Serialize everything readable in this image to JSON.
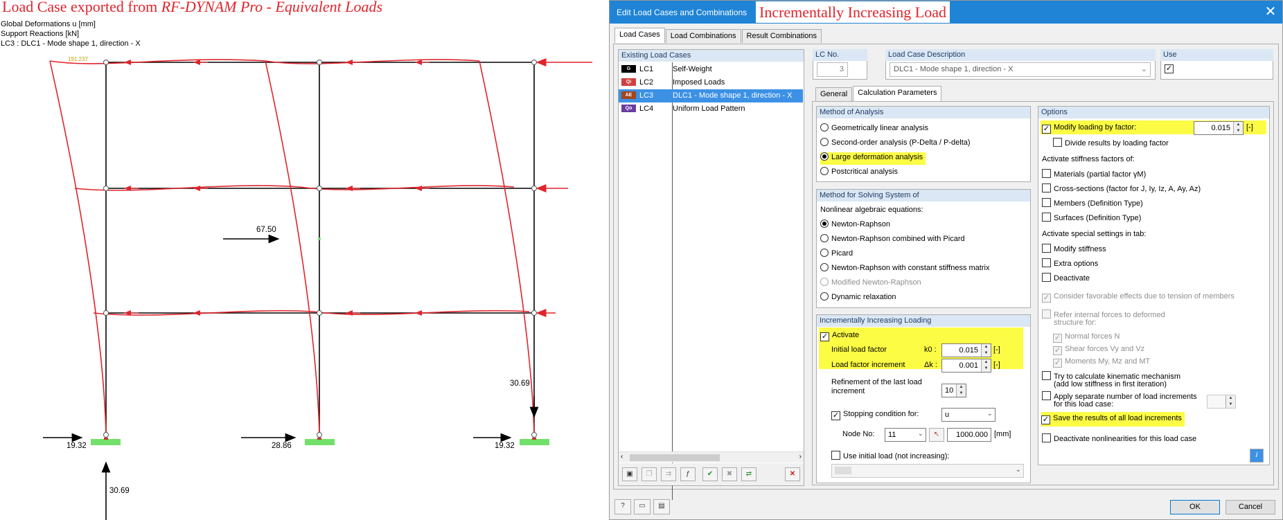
{
  "left_view": {
    "title_plain": "Load Case exported from ",
    "title_italic": "RF-DYNAM Pro - Equivalent Loads",
    "info_lines": [
      "Global Deformations u [mm]",
      "Support Reactions [kN]",
      "LC3 : DLC1 - Mode shape 1, direction - X"
    ],
    "max_label": "191.237",
    "force_67": "67.50",
    "reaction_left": "19.32",
    "reaction_mid": "28.86",
    "reaction_right": "19.32",
    "vertical_right": "30.69",
    "vertical_bottom": "30.69"
  },
  "dialog": {
    "window_title": "Edit Load Cases and Combinations",
    "overlay_title": "Incrementally Increasing Load",
    "close_icon": "close-icon",
    "top_tabs": [
      "Load Cases",
      "Load Combinations",
      "Result Combinations"
    ],
    "existing_label": "Existing Load Cases",
    "load_cases": [
      {
        "badge": "G",
        "color": "#000000",
        "id": "LC1",
        "desc": "Self-Weight"
      },
      {
        "badge": "Qi",
        "color": "#d04040",
        "id": "LC2",
        "desc": "Imposed Loads"
      },
      {
        "badge": "AE",
        "color": "#a0461e",
        "id": "LC3",
        "desc": "DLC1 - Mode shape 1, direction - X"
      },
      {
        "badge": "Qo",
        "color": "#6a3ca0",
        "id": "LC4",
        "desc": "Uniform Load Pattern"
      }
    ],
    "lc_no_label": "LC No.",
    "lc_no_value": "3",
    "desc_label": "Load Case Description",
    "desc_value": "DLC1 - Mode shape 1, direction - X",
    "use_label": "Use",
    "inner_tabs": [
      "General",
      "Calculation Parameters"
    ],
    "method_analysis": {
      "header": "Method of Analysis",
      "options": [
        "Geometrically linear analysis",
        "Second-order analysis (P-Delta / P-delta)",
        "Large deformation analysis",
        "Postcritical analysis"
      ]
    },
    "method_solving": {
      "header": "Method for Solving System of",
      "sub": "Nonlinear algebraic equations:",
      "options": [
        "Newton-Raphson",
        "Newton-Raphson combined with Picard",
        "Picard",
        "Newton-Raphson with constant stiffness matrix",
        "Modified Newton-Raphson",
        "Dynamic relaxation"
      ]
    },
    "incremental": {
      "header": "Incrementally Increasing Loading",
      "activate": "Activate",
      "initial_label": "Initial load factor",
      "initial_sym": "k0 :",
      "initial_value": "0.015",
      "increment_label": "Load factor increment",
      "increment_sym": "Δk :",
      "increment_value": "0.001",
      "unit": "[-]",
      "refinement_label1": "Refinement of the last load",
      "refinement_label2": "increment",
      "refinement_value": "10",
      "stopping_label": "Stopping condition for:",
      "stopping_value": "u",
      "node_label": "Node No:",
      "node_value": "11",
      "node_limit": "1000.000",
      "node_unit": "[mm]",
      "use_initial": "Use initial load (not increasing):"
    },
    "options": {
      "header": "Options",
      "modify": "Modify loading by factor:",
      "modify_value": "0.015",
      "modify_unit": "[-]",
      "divide": "Divide results by loading factor",
      "stiffness_label": "Activate stiffness factors of:",
      "stiffness": [
        "Materials (partial factor γM)",
        "Cross-sections (factor for J, Iy, Iz, A, Ay, Az)",
        "Members (Definition Type)",
        "Surfaces (Definition Type)"
      ],
      "special_label": "Activate special settings in tab:",
      "special": [
        "Modify stiffness",
        "Extra options",
        "Deactivate"
      ],
      "favorable": "Consider favorable effects due to tension of members",
      "refer1": "Refer internal forces to deformed",
      "refer2": "structure for:",
      "refer_items": [
        "Normal forces N",
        "Shear forces Vy and Vz",
        "Moments My, Mz and MT"
      ],
      "kinematic1": "Try to calculate kinematic mechanism",
      "kinematic2": "(add low stiffness in first iteration)",
      "separate1": "Apply separate number of load increments",
      "separate2": "for this load case:",
      "save_results": "Save the results of all load increments",
      "deactivate_nl": "Deactivate nonlinearities for this load case"
    },
    "ok": "OK",
    "cancel": "Cancel"
  }
}
